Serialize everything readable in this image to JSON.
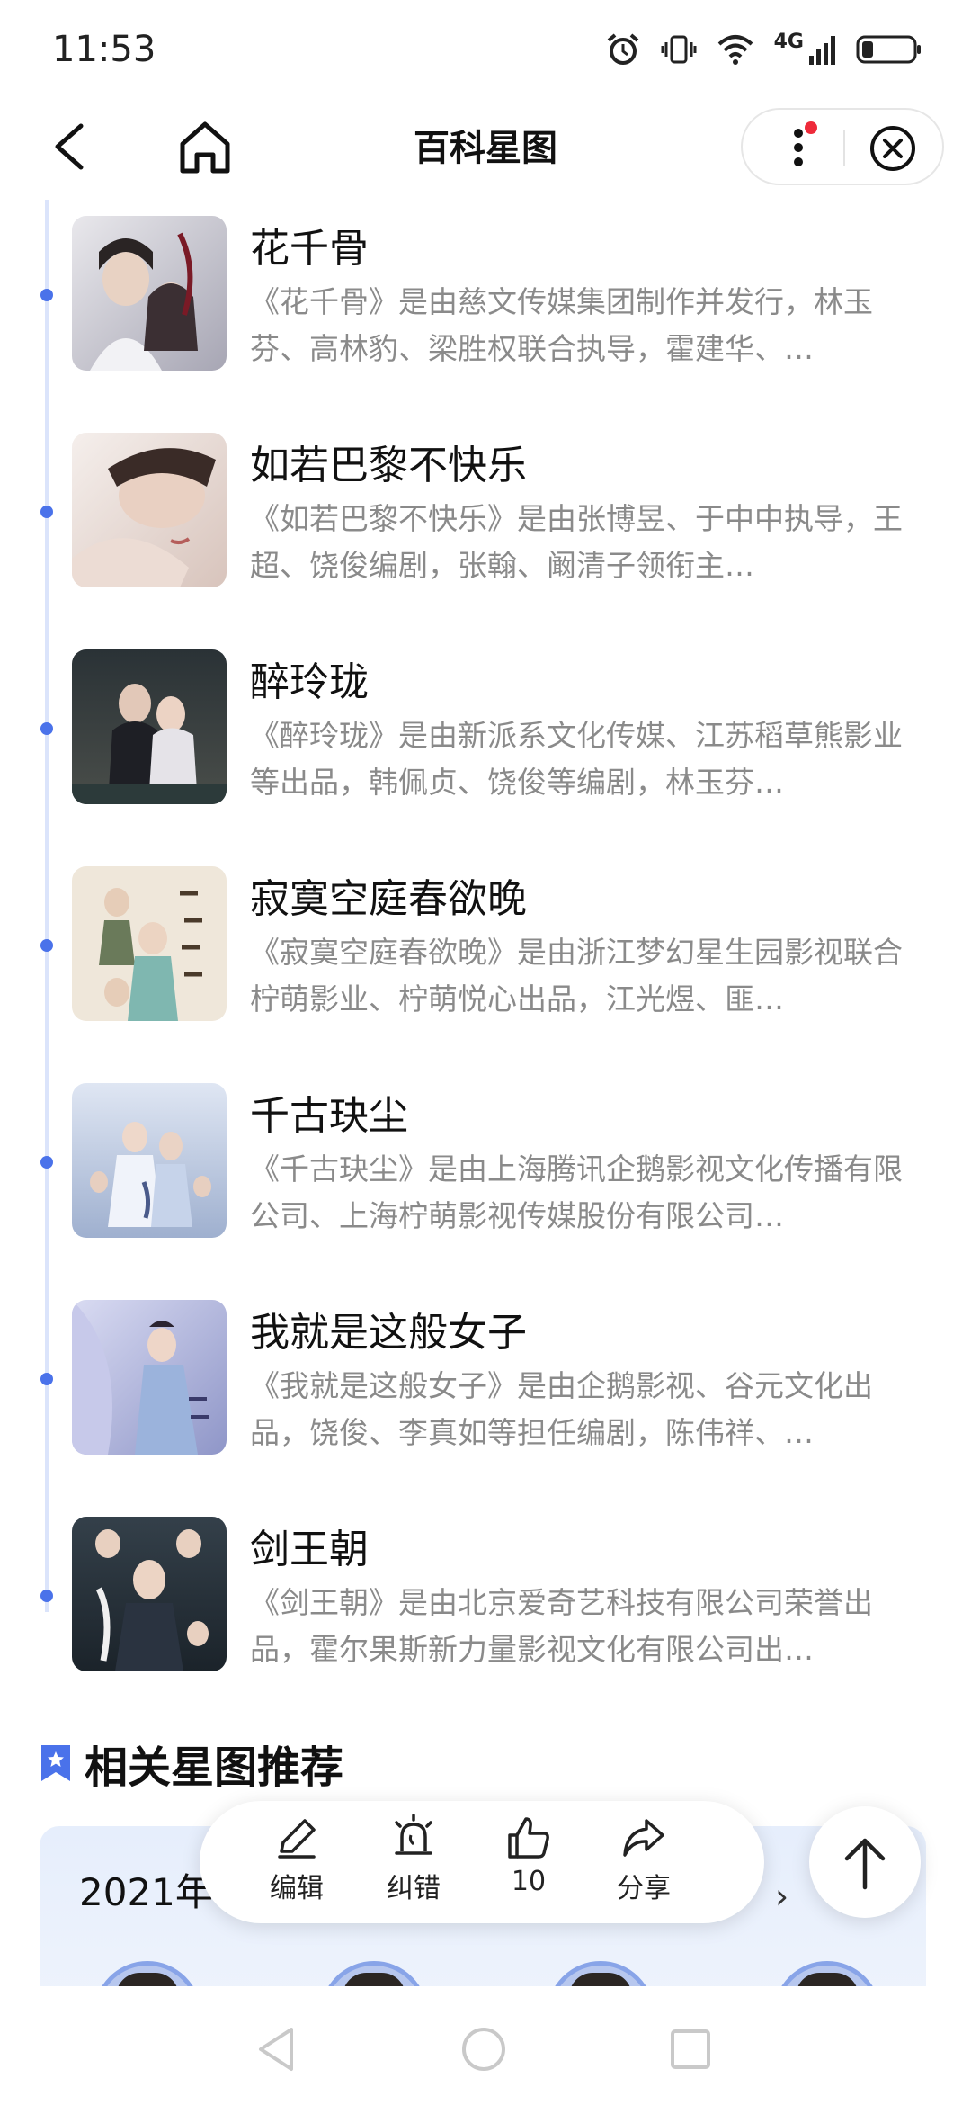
{
  "status_bar": {
    "time": "11:53",
    "network": "4G"
  },
  "header": {
    "title": "百科星图"
  },
  "items": [
    {
      "title": "花千骨",
      "desc": "《花千骨》是由慈文传媒集团制作并发行，林玉芬、高林豹、梁胜权联合执导，霍建华、…"
    },
    {
      "title": "如若巴黎不快乐",
      "desc": "《如若巴黎不快乐》是由张博昱、于中中执导，王超、饶俊编剧，张翰、阚清子领衔主…"
    },
    {
      "title": "醉玲珑",
      "desc": "《醉玲珑》是由新派系文化传媒、江苏稻草熊影业等出品，韩佩贞、饶俊等编剧，林玉芬…"
    },
    {
      "title": "寂寞空庭春欲晚",
      "desc": "《寂寞空庭春欲晚》是由浙江梦幻星生园影视联合柠萌影业、柠萌悦心出品，江光煜、匪…"
    },
    {
      "title": "千古玦尘",
      "desc": "《千古玦尘》是由上海腾讯企鹅影视文化传播有限公司、上海柠萌影视传媒股份有限公司…"
    },
    {
      "title": "我就是这般女子",
      "desc": "《我就是这般女子》是由企鹅影视、谷元文化出品，饶俊、李真如等担任编剧，陈伟祥、…"
    },
    {
      "title": "剑王朝",
      "desc": "《剑王朝》是由北京爱奇艺科技有限公司荣誉出品，霍尔果斯新力量影视文化有限公司出…"
    }
  ],
  "related": {
    "title": "相关星图推荐",
    "card_year": "2021年",
    "arrow": "›"
  },
  "actions": {
    "edit": "编辑",
    "report": "纠错",
    "like_count": "10",
    "share": "分享"
  },
  "colors": {
    "accent": "#4a72ea",
    "timeline": "#dbe4fb",
    "desc_text": "#8a8a8a"
  }
}
